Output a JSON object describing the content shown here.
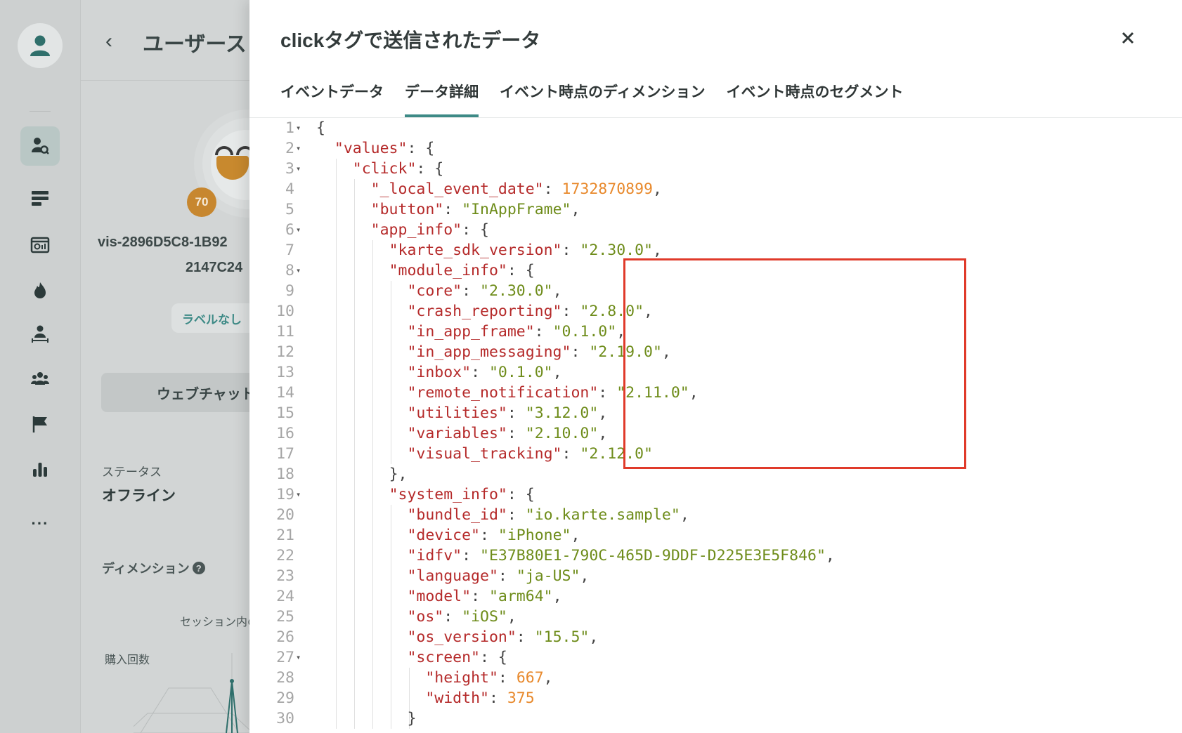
{
  "background": {
    "header_title": "ユーザースト",
    "score": "70",
    "visitor_id_line1": "vis-2896D5C8-1B92",
    "visitor_id_line2": "2147C24",
    "label_chip": "ラベルなし",
    "chat_button": "ウェブチャット",
    "status_label": "ステータス",
    "status_value": "オフライン",
    "dimension_label": "ディメンション",
    "session_label": "セッション内の",
    "purchase_count_label": "購入回数",
    "more_menu": "···"
  },
  "modal": {
    "title": "clickタグで送信されたデータ",
    "tabs": [
      {
        "label": "イベントデータ",
        "active": false
      },
      {
        "label": "データ詳細",
        "active": true
      },
      {
        "label": "イベント時点のディメンション",
        "active": false
      },
      {
        "label": "イベント時点のセグメント",
        "active": false
      }
    ],
    "code_lines": [
      {
        "n": "1",
        "fold": true,
        "text": "{"
      },
      {
        "n": "2",
        "fold": true,
        "text": "  \"values\": {"
      },
      {
        "n": "3",
        "fold": true,
        "text": "    \"click\": {"
      },
      {
        "n": "4",
        "fold": false,
        "text": "      \"_local_event_date\": 1732870899,"
      },
      {
        "n": "5",
        "fold": false,
        "text": "      \"button\": \"InAppFrame\","
      },
      {
        "n": "6",
        "fold": true,
        "text": "      \"app_info\": {"
      },
      {
        "n": "7",
        "fold": false,
        "text": "        \"karte_sdk_version\": \"2.30.0\","
      },
      {
        "n": "8",
        "fold": true,
        "text": "        \"module_info\": {"
      },
      {
        "n": "9",
        "fold": false,
        "text": "          \"core\": \"2.30.0\","
      },
      {
        "n": "10",
        "fold": false,
        "text": "          \"crash_reporting\": \"2.8.0\","
      },
      {
        "n": "11",
        "fold": false,
        "text": "          \"in_app_frame\": \"0.1.0\","
      },
      {
        "n": "12",
        "fold": false,
        "text": "          \"in_app_messaging\": \"2.19.0\","
      },
      {
        "n": "13",
        "fold": false,
        "text": "          \"inbox\": \"0.1.0\","
      },
      {
        "n": "14",
        "fold": false,
        "text": "          \"remote_notification\": \"2.11.0\","
      },
      {
        "n": "15",
        "fold": false,
        "text": "          \"utilities\": \"3.12.0\","
      },
      {
        "n": "16",
        "fold": false,
        "text": "          \"variables\": \"2.10.0\","
      },
      {
        "n": "17",
        "fold": false,
        "text": "          \"visual_tracking\": \"2.12.0\""
      },
      {
        "n": "18",
        "fold": false,
        "text": "        },"
      },
      {
        "n": "19",
        "fold": true,
        "text": "        \"system_info\": {"
      },
      {
        "n": "20",
        "fold": false,
        "text": "          \"bundle_id\": \"io.karte.sample\","
      },
      {
        "n": "21",
        "fold": false,
        "text": "          \"device\": \"iPhone\","
      },
      {
        "n": "22",
        "fold": false,
        "text": "          \"idfv\": \"E37B80E1-790C-465D-9DDF-D225E3E5F846\","
      },
      {
        "n": "23",
        "fold": false,
        "text": "          \"language\": \"ja-US\","
      },
      {
        "n": "24",
        "fold": false,
        "text": "          \"model\": \"arm64\","
      },
      {
        "n": "25",
        "fold": false,
        "text": "          \"os\": \"iOS\","
      },
      {
        "n": "26",
        "fold": false,
        "text": "          \"os_version\": \"15.5\","
      },
      {
        "n": "27",
        "fold": true,
        "text": "          \"screen\": {"
      },
      {
        "n": "28",
        "fold": false,
        "text": "            \"height\": 667,"
      },
      {
        "n": "29",
        "fold": false,
        "text": "            \"width\": 375"
      },
      {
        "n": "30",
        "fold": false,
        "text": "          }"
      }
    ]
  },
  "colors": {
    "accent": "#3d8a86",
    "key": "#b52a2a",
    "string": "#6e8c1a",
    "number": "#e8892c",
    "highlight": "#e03a2a"
  }
}
